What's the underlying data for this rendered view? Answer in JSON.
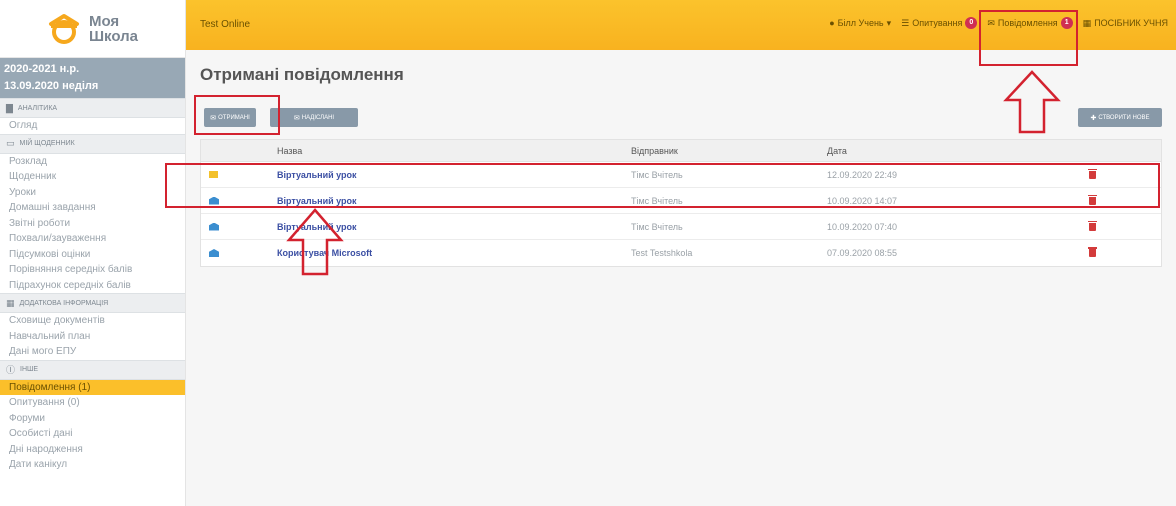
{
  "logo": {
    "line1": "Моя",
    "line2": "Школа"
  },
  "sidebar": {
    "year": "2020-2021 н.р.",
    "date": "13.09.2020 неділя",
    "sections": [
      {
        "title": "Аналітика",
        "icon": "bar-chart-icon",
        "items": [
          "Огляд"
        ]
      },
      {
        "title": "Мій щоденник",
        "icon": "book-icon",
        "items": [
          "Розклад",
          "Щоденник",
          "Уроки",
          "Домашні завдання",
          "Звітні роботи",
          "Похвали/зауваження",
          "Підсумкові оцінки",
          "Порівняння середніх балів",
          "Підрахунок середніх балів"
        ]
      },
      {
        "title": "Додаткова інформація",
        "icon": "calendar-icon",
        "items": [
          "Сховище документів",
          "Навчальний план",
          "Дані мого ЕПУ"
        ]
      },
      {
        "title": "Інше",
        "icon": "info-icon",
        "items": [
          "Повідомлення (1)",
          "Опитування (0)",
          "Форуми",
          "Особисті дані",
          "Дні народження",
          "Дати канікул"
        ]
      }
    ],
    "active_item": "Повідомлення (1)"
  },
  "topbar": {
    "title": "Test Online",
    "user": "Білл Учень",
    "surveys_label": "Опитування",
    "surveys_count": "0",
    "messages_label": "Повідомлення",
    "messages_count": "1",
    "guide_label": "ПОСІБНИК УЧНЯ"
  },
  "main": {
    "title": "Отримані повідомлення",
    "btn_received": "Отримані",
    "btn_sent": "Надіслані",
    "btn_create": "Створити нове",
    "columns": {
      "name": "Назва",
      "sender": "Відправник",
      "date": "Дата"
    },
    "rows": [
      {
        "state": "unread",
        "subject": "Віртуальний урок",
        "sender": "Тімс Вчітель",
        "date": "12.09.2020 22:49"
      },
      {
        "state": "read",
        "subject": "Віртуальний урок",
        "sender": "Тімс Вчітель",
        "date": "10.09.2020 14:07"
      },
      {
        "state": "read",
        "subject": "Віртуальний урок",
        "sender": "Тімс Вчітель",
        "date": "10.09.2020 07:40"
      },
      {
        "state": "read",
        "subject": "Користувач Microsoft",
        "sender": "Test Testshkola",
        "date": "07.09.2020 08:55"
      }
    ]
  },
  "colors": {
    "accent": "#fbbf2a",
    "sidebar_date_bg": "#98a8b5",
    "link": "#3b4fa3",
    "badge": "#d02f52",
    "annotation": "#d3222f"
  }
}
